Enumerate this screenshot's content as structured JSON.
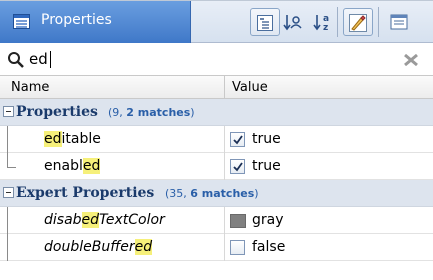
{
  "header": {
    "title": "Properties",
    "toolbar_icons": [
      "categorized-icon",
      "sort-by-category-icon",
      "sort-alphabetical-icon",
      "show-expert-icon",
      "help-icon"
    ]
  },
  "search": {
    "value": "ed",
    "icon": "search-icon",
    "clear_icon": "close-icon"
  },
  "columns": {
    "name": "Name",
    "value": "Value"
  },
  "highlight_color": "#f6f07a",
  "categories": [
    {
      "label": "Properties",
      "total": "9",
      "matches": "2 matches",
      "rows": [
        {
          "name_pre": "",
          "name_hl": "ed",
          "name_post": "itable",
          "value": "true",
          "checked": true
        },
        {
          "name_pre": "enabl",
          "name_hl": "ed",
          "name_post": "",
          "value": "true",
          "checked": true
        }
      ]
    },
    {
      "label": "Expert Properties",
      "total": "35",
      "matches": "6 matches",
      "rows": [
        {
          "name_pre": "disab",
          "name_hl": "ed",
          "name_post": "TextColor",
          "value": "gray",
          "swatch": "#808080"
        },
        {
          "name_pre": "doubleBuffer",
          "name_hl": "ed",
          "name_post": "",
          "value": "false",
          "checked": false
        }
      ]
    }
  ]
}
